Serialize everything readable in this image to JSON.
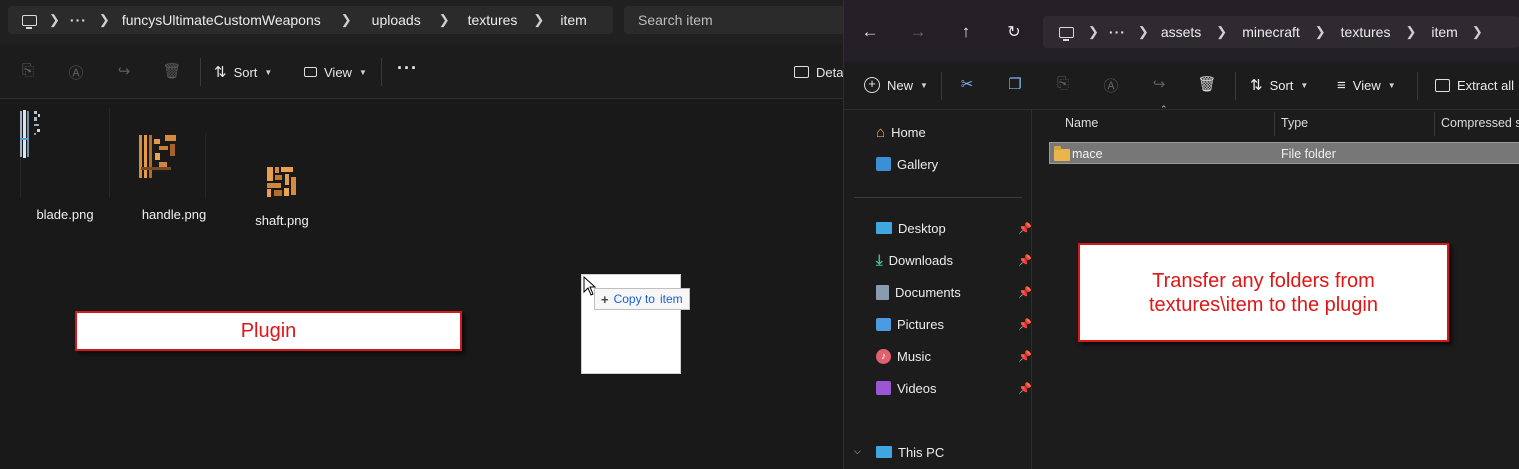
{
  "left_window": {
    "breadcrumb": [
      "funcysUltimateCustomWeapons",
      "uploads",
      "textures",
      "item"
    ],
    "search_placeholder": "Search item",
    "toolbar": {
      "sort_label": "Sort",
      "view_label": "View",
      "details_label": "Deta"
    },
    "files": [
      {
        "name": "blade.png"
      },
      {
        "name": "handle.png"
      },
      {
        "name": "shaft.png"
      }
    ],
    "callout_text": "Plugin",
    "drag_tooltip": {
      "prefix": "Copy to",
      "target": "item"
    }
  },
  "right_window": {
    "breadcrumb": [
      "assets",
      "minecraft",
      "textures",
      "item"
    ],
    "command_bar": {
      "new_label": "New",
      "sort_label": "Sort",
      "view_label": "View",
      "extract_label": "Extract all"
    },
    "nav_items": [
      {
        "label": "Home",
        "icon": "home-icon",
        "pinned": false
      },
      {
        "label": "Gallery",
        "icon": "gallery-icon",
        "pinned": false
      },
      {
        "label": "Desktop",
        "icon": "desktop-icon",
        "pinned": true
      },
      {
        "label": "Downloads",
        "icon": "download-icon",
        "pinned": true
      },
      {
        "label": "Documents",
        "icon": "documents-icon",
        "pinned": true
      },
      {
        "label": "Pictures",
        "icon": "pictures-icon",
        "pinned": true
      },
      {
        "label": "Music",
        "icon": "music-icon",
        "pinned": true
      },
      {
        "label": "Videos",
        "icon": "videos-icon",
        "pinned": true
      },
      {
        "label": "This PC",
        "icon": "pc-icon",
        "pinned": false
      }
    ],
    "columns": [
      "Name",
      "Type",
      "Compressed siz"
    ],
    "rows": [
      {
        "name": "mace",
        "type": "File folder"
      }
    ],
    "callout_text_line1": "Transfer any folders from",
    "callout_text_line2": "textures\\item to the plugin"
  },
  "colors": {
    "callout_border": "#d51818",
    "callout_text": "#e01515",
    "folder": "#e8b64a",
    "selected_row": "#777777"
  }
}
